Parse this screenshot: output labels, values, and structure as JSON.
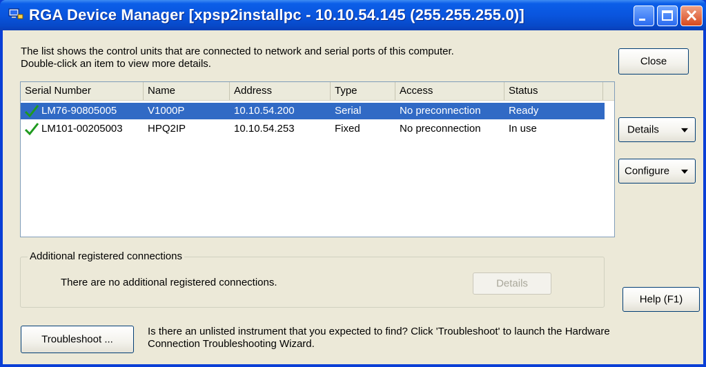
{
  "window": {
    "title": "RGA Device Manager [xpsp2installpc - 10.10.54.145 (255.255.255.0)]"
  },
  "intro": {
    "line1": "The list shows the control units that are connected to network and serial ports of this computer.",
    "line2": "Double-click an item to view more details."
  },
  "buttons": {
    "close": "Close",
    "details": "Details",
    "configure": "Configure",
    "help": "Help (F1)",
    "troubleshoot": "Troubleshoot ...",
    "group_details": "Details"
  },
  "table": {
    "columns": [
      "Serial Number",
      "Name",
      "Address",
      "Type",
      "Access",
      "Status"
    ],
    "rows": [
      [
        "LM76-90805005",
        "V1000P",
        "10.10.54.200",
        "Serial",
        "No preconnection",
        "Ready"
      ],
      [
        "LM101-00205003",
        "HPQ2IP",
        "10.10.54.253",
        "Fixed",
        "No preconnection",
        "In use"
      ]
    ]
  },
  "additional": {
    "title": "Additional registered connections",
    "message": "There are no additional registered connections."
  },
  "troubleshoot_msg": {
    "line1": "Is there an unlisted instrument that you expected to find?  Click 'Troubleshoot' to launch the Hardware",
    "line2": "Connection Troubleshooting Wizard."
  },
  "colors": {
    "selection": "#316ac5",
    "check": "#1f9a1f",
    "face": "#ece9d8",
    "titlebar": "#0a55de"
  }
}
